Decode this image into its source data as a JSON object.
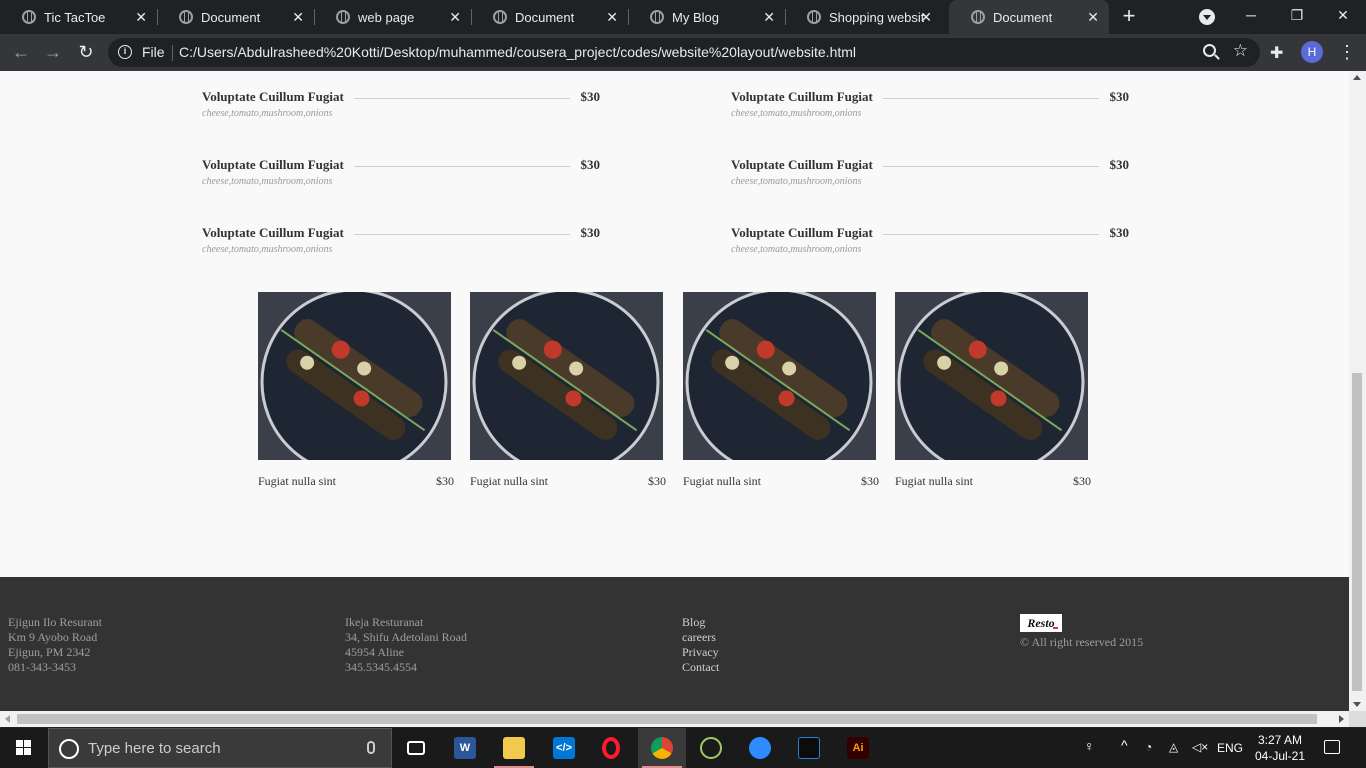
{
  "browser": {
    "tabs": [
      {
        "title": "Tic TacToe",
        "active": false
      },
      {
        "title": "Document",
        "active": false
      },
      {
        "title": "web page",
        "active": false
      },
      {
        "title": "Document",
        "active": false
      },
      {
        "title": "My Blog",
        "active": false
      },
      {
        "title": "Shopping website",
        "active": false
      },
      {
        "title": "Document",
        "active": true
      }
    ],
    "address": {
      "scheme_label": "File",
      "url": "C:/Users/Abdulrasheed%20Kotti/Desktop/muhammed/cousera_project/codes/website%20layout/website.html"
    },
    "profile_initial": "H"
  },
  "menu_items": [
    {
      "name": "Voluptate Cuillum Fugiat",
      "price": "$30",
      "desc": "cheese,tomato,mushroom,onions"
    },
    {
      "name": "Voluptate Cuillum Fugiat",
      "price": "$30",
      "desc": "cheese,tomato,mushroom,onions"
    },
    {
      "name": "Voluptate Cuillum Fugiat",
      "price": "$30",
      "desc": "cheese,tomato,mushroom,onions"
    },
    {
      "name": "Voluptate Cuillum Fugiat",
      "price": "$30",
      "desc": "cheese,tomato,mushroom,onions"
    },
    {
      "name": "Voluptate Cuillum Fugiat",
      "price": "$30",
      "desc": "cheese,tomato,mushroom,onions"
    },
    {
      "name": "Voluptate Cuillum Fugiat",
      "price": "$30",
      "desc": "cheese,tomato,mushroom,onions"
    }
  ],
  "cards": [
    {
      "name": "Fugiat nulla sint",
      "price": "$30"
    },
    {
      "name": "Fugiat nulla sint",
      "price": "$30"
    },
    {
      "name": "Fugiat nulla sint",
      "price": "$30"
    },
    {
      "name": "Fugiat nulla sint",
      "price": "$30"
    }
  ],
  "footer": {
    "col1": [
      "Ejigun Ilo Resurant",
      "Km 9 Ayobo Road",
      "Ejigun, PM 2342",
      "081-343-3453"
    ],
    "col2": [
      "Ikeja Resturanat",
      "34, Shifu Adetolani Road",
      "45954 Aline",
      "345.5345.4554"
    ],
    "links": [
      "Blog",
      "careers",
      "Privacy",
      "Contact"
    ],
    "logo_text": "Resto",
    "copyright": "© All right reserved 2015"
  },
  "taskbar": {
    "search_placeholder": "Type here to search",
    "apps": [
      "task-view",
      "word",
      "file-explorer",
      "vscode",
      "opera",
      "chrome",
      "game-bar",
      "zoom",
      "terminal",
      "illustrator"
    ],
    "illustrator_label": "Ai",
    "language": "ENG",
    "time": "3:27 AM",
    "date": "04-Jul-21"
  }
}
